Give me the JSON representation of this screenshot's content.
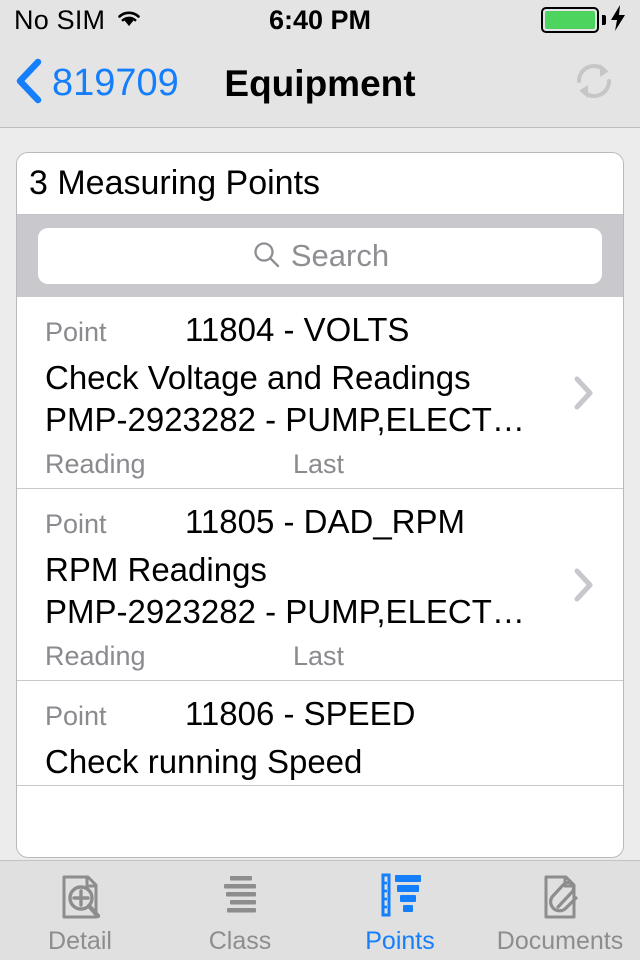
{
  "statusbar": {
    "carrier": "No SIM",
    "wifi_icon": "wifi-icon",
    "time": "6:40 PM",
    "battery_icon": "battery-full-icon",
    "charging_icon": "charging-bolt-icon"
  },
  "navbar": {
    "back_label": "819709",
    "back_icon": "chevron-left-icon",
    "title": "Equipment",
    "refresh_icon": "refresh-icon"
  },
  "card": {
    "header_title": "3 Measuring Points",
    "search": {
      "placeholder": "Search",
      "value": "",
      "icon": "search-icon"
    },
    "labels": {
      "point": "Point",
      "reading": "Reading",
      "last": "Last"
    },
    "rows": [
      {
        "point_label": "Point",
        "point_value": "11804 - VOLTS",
        "description": "Check Voltage and Readings",
        "equipment": "PMP-2923282 - PUMP,ELECT…",
        "reading_label": "Reading",
        "last_label": "Last",
        "disclosure_icon": "chevron-right-icon"
      },
      {
        "point_label": "Point",
        "point_value": "11805 - DAD_RPM",
        "description": "RPM Readings",
        "equipment": "PMP-2923282 - PUMP,ELECT…",
        "reading_label": "Reading",
        "last_label": "Last",
        "disclosure_icon": "chevron-right-icon"
      },
      {
        "point_label": "Point",
        "point_value": "11806 - SPEED",
        "description": "Check running Speed",
        "equipment": "",
        "reading_label": "",
        "last_label": "",
        "disclosure_icon": "chevron-right-icon"
      }
    ]
  },
  "tabbar": {
    "tabs": [
      {
        "label": "Detail",
        "icon": "document-search-icon",
        "active": false
      },
      {
        "label": "Class",
        "icon": "lines-list-icon",
        "active": false
      },
      {
        "label": "Points",
        "icon": "ruler-funnel-icon",
        "active": true
      },
      {
        "label": "Documents",
        "icon": "document-paperclip-icon",
        "active": false
      }
    ]
  },
  "colors": {
    "accent": "#157efb",
    "battery_green": "#4cd45e",
    "muted_text": "#8a8a8f",
    "searchbar_bg": "#c8c8cd"
  }
}
